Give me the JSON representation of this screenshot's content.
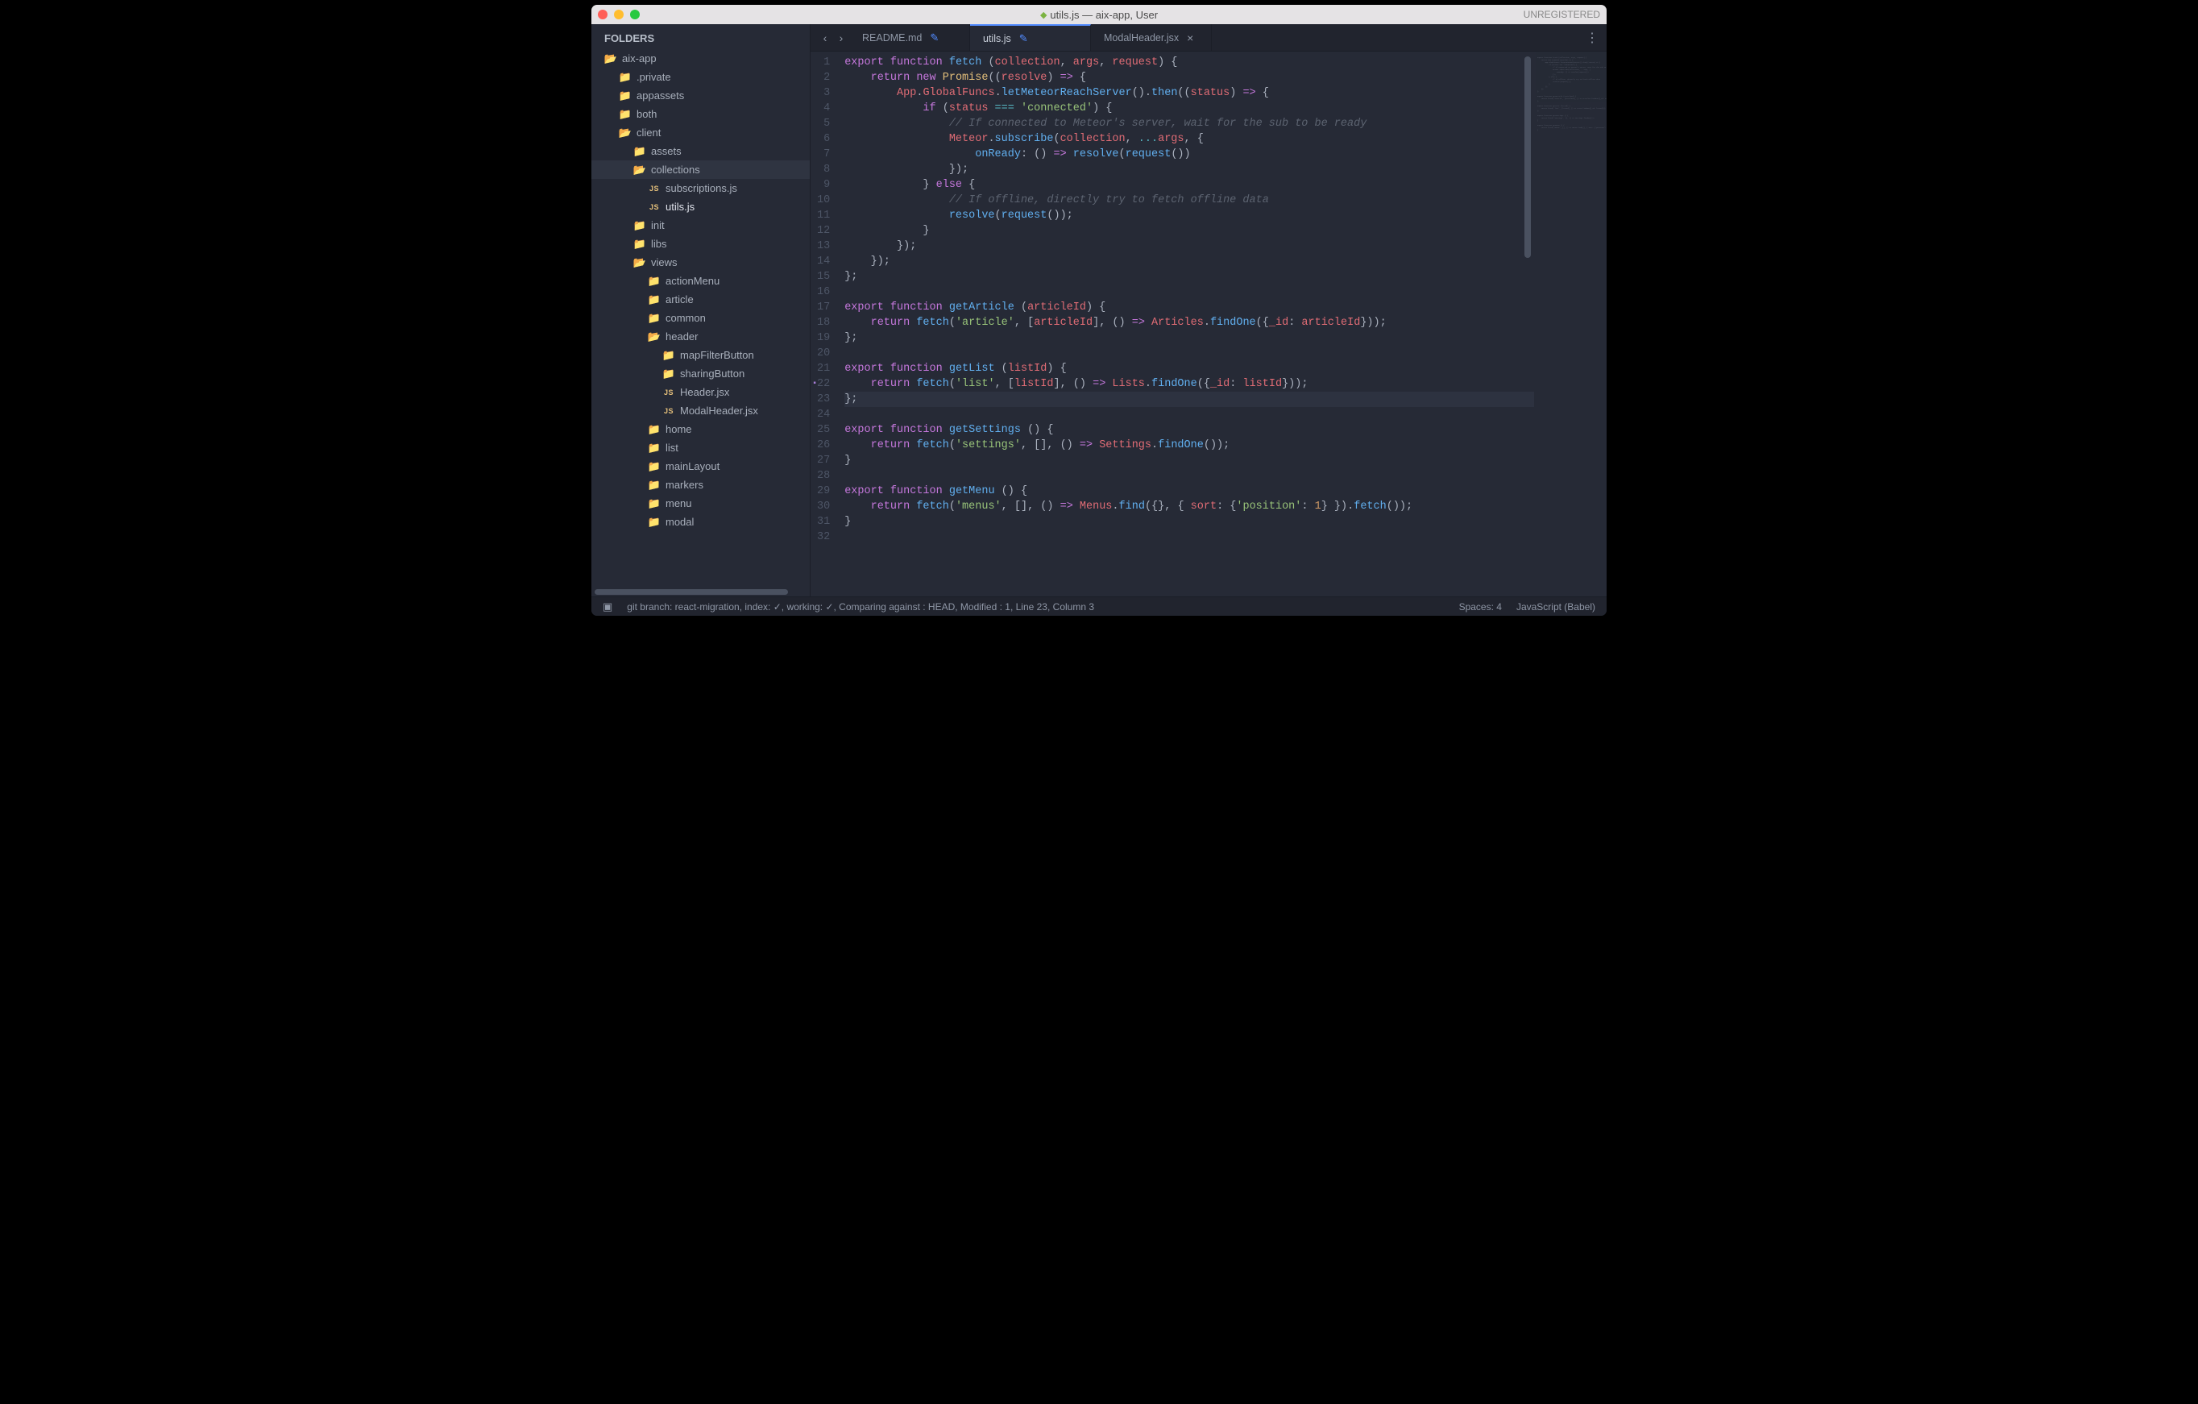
{
  "titlebar": {
    "title": "utils.js — aix-app, User",
    "right": "UNREGISTERED"
  },
  "sidebar": {
    "header": "FOLDERS",
    "tree": [
      {
        "label": "aix-app",
        "depth": 0,
        "icon": "openfolder"
      },
      {
        "label": ".private",
        "depth": 1,
        "icon": "folder"
      },
      {
        "label": "appassets",
        "depth": 1,
        "icon": "folder"
      },
      {
        "label": "both",
        "depth": 1,
        "icon": "folder"
      },
      {
        "label": "client",
        "depth": 1,
        "icon": "openfolder"
      },
      {
        "label": "assets",
        "depth": 2,
        "icon": "folder"
      },
      {
        "label": "collections",
        "depth": 2,
        "icon": "openfolder",
        "selected": true
      },
      {
        "label": "subscriptions.js",
        "depth": 3,
        "icon": "js"
      },
      {
        "label": "utils.js",
        "depth": 3,
        "icon": "js",
        "active": true
      },
      {
        "label": "init",
        "depth": 2,
        "icon": "folder"
      },
      {
        "label": "libs",
        "depth": 2,
        "icon": "folder"
      },
      {
        "label": "views",
        "depth": 2,
        "icon": "openfolder"
      },
      {
        "label": "actionMenu",
        "depth": 3,
        "icon": "folder"
      },
      {
        "label": "article",
        "depth": 3,
        "icon": "folder"
      },
      {
        "label": "common",
        "depth": 3,
        "icon": "folder"
      },
      {
        "label": "header",
        "depth": 3,
        "icon": "openfolder"
      },
      {
        "label": "mapFilterButton",
        "depth": 4,
        "icon": "folder"
      },
      {
        "label": "sharingButton",
        "depth": 4,
        "icon": "folder"
      },
      {
        "label": "Header.jsx",
        "depth": 4,
        "icon": "js"
      },
      {
        "label": "ModalHeader.jsx",
        "depth": 4,
        "icon": "js"
      },
      {
        "label": "home",
        "depth": 3,
        "icon": "folder"
      },
      {
        "label": "list",
        "depth": 3,
        "icon": "folder"
      },
      {
        "label": "mainLayout",
        "depth": 3,
        "icon": "folder"
      },
      {
        "label": "markers",
        "depth": 3,
        "icon": "folder"
      },
      {
        "label": "menu",
        "depth": 3,
        "icon": "folder"
      },
      {
        "label": "modal",
        "depth": 3,
        "icon": "folder"
      }
    ]
  },
  "tabs": [
    {
      "label": "README.md",
      "dirty": true,
      "active": false,
      "closable": false
    },
    {
      "label": "utils.js",
      "dirty": true,
      "active": true,
      "closable": false
    },
    {
      "label": "ModalHeader.jsx",
      "dirty": false,
      "active": false,
      "closable": true
    }
  ],
  "code": {
    "highlight_line": 23,
    "mark_line": 22,
    "lines": [
      [
        [
          "kw",
          "export"
        ],
        [
          "punc",
          " "
        ],
        [
          "kw",
          "function"
        ],
        [
          "punc",
          " "
        ],
        [
          "fn",
          "fetch"
        ],
        [
          "punc",
          " ("
        ],
        [
          "var",
          "collection"
        ],
        [
          "punc",
          ", "
        ],
        [
          "var",
          "args"
        ],
        [
          "punc",
          ", "
        ],
        [
          "var",
          "request"
        ],
        [
          "punc",
          ") {"
        ]
      ],
      [
        [
          "punc",
          "    "
        ],
        [
          "kw",
          "return"
        ],
        [
          "punc",
          " "
        ],
        [
          "kw",
          "new"
        ],
        [
          "punc",
          " "
        ],
        [
          "obj",
          "Promise"
        ],
        [
          "punc",
          "(("
        ],
        [
          "var",
          "resolve"
        ],
        [
          "punc",
          ") "
        ],
        [
          "kw",
          "=>"
        ],
        [
          "punc",
          " {"
        ]
      ],
      [
        [
          "punc",
          "        "
        ],
        [
          "var",
          "App"
        ],
        [
          "punc",
          "."
        ],
        [
          "var",
          "GlobalFuncs"
        ],
        [
          "punc",
          "."
        ],
        [
          "fn",
          "letMeteorReachServer"
        ],
        [
          "punc",
          "()."
        ],
        [
          "fn",
          "then"
        ],
        [
          "punc",
          "(("
        ],
        [
          "var",
          "status"
        ],
        [
          "punc",
          ") "
        ],
        [
          "kw",
          "=>"
        ],
        [
          "punc",
          " {"
        ]
      ],
      [
        [
          "punc",
          "            "
        ],
        [
          "kw",
          "if"
        ],
        [
          "punc",
          " ("
        ],
        [
          "var",
          "status"
        ],
        [
          "punc",
          " "
        ],
        [
          "op",
          "==="
        ],
        [
          "punc",
          " "
        ],
        [
          "str",
          "'connected'"
        ],
        [
          "punc",
          ") {"
        ]
      ],
      [
        [
          "punc",
          "                "
        ],
        [
          "cmt",
          "// If connected to Meteor's server, wait for the sub to be ready"
        ]
      ],
      [
        [
          "punc",
          "                "
        ],
        [
          "var",
          "Meteor"
        ],
        [
          "punc",
          "."
        ],
        [
          "fn",
          "subscribe"
        ],
        [
          "punc",
          "("
        ],
        [
          "var",
          "collection"
        ],
        [
          "punc",
          ", "
        ],
        [
          "op",
          "..."
        ],
        [
          "var",
          "args"
        ],
        [
          "punc",
          ", {"
        ]
      ],
      [
        [
          "punc",
          "                    "
        ],
        [
          "fn",
          "onReady"
        ],
        [
          "punc",
          ": () "
        ],
        [
          "kw",
          "=>"
        ],
        [
          "punc",
          " "
        ],
        [
          "fn",
          "resolve"
        ],
        [
          "punc",
          "("
        ],
        [
          "fn",
          "request"
        ],
        [
          "punc",
          "())"
        ]
      ],
      [
        [
          "punc",
          "                });"
        ]
      ],
      [
        [
          "punc",
          "            } "
        ],
        [
          "kw",
          "else"
        ],
        [
          "punc",
          " {"
        ]
      ],
      [
        [
          "punc",
          "                "
        ],
        [
          "cmt",
          "// If offline, directly try to fetch offline data"
        ]
      ],
      [
        [
          "punc",
          "                "
        ],
        [
          "fn",
          "resolve"
        ],
        [
          "punc",
          "("
        ],
        [
          "fn",
          "request"
        ],
        [
          "punc",
          "());"
        ]
      ],
      [
        [
          "punc",
          "            }"
        ]
      ],
      [
        [
          "punc",
          "        });"
        ]
      ],
      [
        [
          "punc",
          "    });"
        ]
      ],
      [
        [
          "punc",
          "};"
        ]
      ],
      [],
      [
        [
          "kw",
          "export"
        ],
        [
          "punc",
          " "
        ],
        [
          "kw",
          "function"
        ],
        [
          "punc",
          " "
        ],
        [
          "fn",
          "getArticle"
        ],
        [
          "punc",
          " ("
        ],
        [
          "var",
          "articleId"
        ],
        [
          "punc",
          ") {"
        ]
      ],
      [
        [
          "punc",
          "    "
        ],
        [
          "kw",
          "return"
        ],
        [
          "punc",
          " "
        ],
        [
          "fn",
          "fetch"
        ],
        [
          "punc",
          "("
        ],
        [
          "str",
          "'article'"
        ],
        [
          "punc",
          ", ["
        ],
        [
          "var",
          "articleId"
        ],
        [
          "punc",
          "], () "
        ],
        [
          "kw",
          "=>"
        ],
        [
          "punc",
          " "
        ],
        [
          "var",
          "Articles"
        ],
        [
          "punc",
          "."
        ],
        [
          "fn",
          "findOne"
        ],
        [
          "punc",
          "({"
        ],
        [
          "var",
          "_id"
        ],
        [
          "punc",
          ": "
        ],
        [
          "var",
          "articleId"
        ],
        [
          "punc",
          "}));"
        ]
      ],
      [
        [
          "punc",
          "};"
        ]
      ],
      [],
      [
        [
          "kw",
          "export"
        ],
        [
          "punc",
          " "
        ],
        [
          "kw",
          "function"
        ],
        [
          "punc",
          " "
        ],
        [
          "fn",
          "getList"
        ],
        [
          "punc",
          " ("
        ],
        [
          "var",
          "listId"
        ],
        [
          "punc",
          ") {"
        ]
      ],
      [
        [
          "punc",
          "    "
        ],
        [
          "kw",
          "return"
        ],
        [
          "punc",
          " "
        ],
        [
          "fn",
          "fetch"
        ],
        [
          "punc",
          "("
        ],
        [
          "str",
          "'list'"
        ],
        [
          "punc",
          ", ["
        ],
        [
          "var",
          "listId"
        ],
        [
          "punc",
          "], () "
        ],
        [
          "kw",
          "=>"
        ],
        [
          "punc",
          " "
        ],
        [
          "var",
          "Lists"
        ],
        [
          "punc",
          "."
        ],
        [
          "fn",
          "findOne"
        ],
        [
          "punc",
          "({"
        ],
        [
          "var",
          "_id"
        ],
        [
          "punc",
          ": "
        ],
        [
          "var",
          "listId"
        ],
        [
          "punc",
          "}));"
        ]
      ],
      [
        [
          "punc",
          "};"
        ]
      ],
      [],
      [
        [
          "kw",
          "export"
        ],
        [
          "punc",
          " "
        ],
        [
          "kw",
          "function"
        ],
        [
          "punc",
          " "
        ],
        [
          "fn",
          "getSettings"
        ],
        [
          "punc",
          " () {"
        ]
      ],
      [
        [
          "punc",
          "    "
        ],
        [
          "kw",
          "return"
        ],
        [
          "punc",
          " "
        ],
        [
          "fn",
          "fetch"
        ],
        [
          "punc",
          "("
        ],
        [
          "str",
          "'settings'"
        ],
        [
          "punc",
          ", [], () "
        ],
        [
          "kw",
          "=>"
        ],
        [
          "punc",
          " "
        ],
        [
          "var",
          "Settings"
        ],
        [
          "punc",
          "."
        ],
        [
          "fn",
          "findOne"
        ],
        [
          "punc",
          "());"
        ]
      ],
      [
        [
          "punc",
          "}"
        ]
      ],
      [],
      [
        [
          "kw",
          "export"
        ],
        [
          "punc",
          " "
        ],
        [
          "kw",
          "function"
        ],
        [
          "punc",
          " "
        ],
        [
          "fn",
          "getMenu"
        ],
        [
          "punc",
          " () {"
        ]
      ],
      [
        [
          "punc",
          "    "
        ],
        [
          "kw",
          "return"
        ],
        [
          "punc",
          " "
        ],
        [
          "fn",
          "fetch"
        ],
        [
          "punc",
          "("
        ],
        [
          "str",
          "'menus'"
        ],
        [
          "punc",
          ", [], () "
        ],
        [
          "kw",
          "=>"
        ],
        [
          "punc",
          " "
        ],
        [
          "var",
          "Menus"
        ],
        [
          "punc",
          "."
        ],
        [
          "fn",
          "find"
        ],
        [
          "punc",
          "({}, { "
        ],
        [
          "var",
          "sort"
        ],
        [
          "punc",
          ": {"
        ],
        [
          "str",
          "'position'"
        ],
        [
          "punc",
          ": "
        ],
        [
          "prop",
          "1"
        ],
        [
          "punc",
          "} })."
        ],
        [
          "fn",
          "fetch"
        ],
        [
          "punc",
          "());"
        ]
      ],
      [
        [
          "punc",
          "}"
        ]
      ],
      []
    ]
  },
  "statusbar": {
    "main": "git branch: react-migration, index: ✓, working: ✓, Comparing against : HEAD, Modified : 1, Line 23, Column 3",
    "spaces": "Spaces: 4",
    "syntax": "JavaScript (Babel)"
  }
}
